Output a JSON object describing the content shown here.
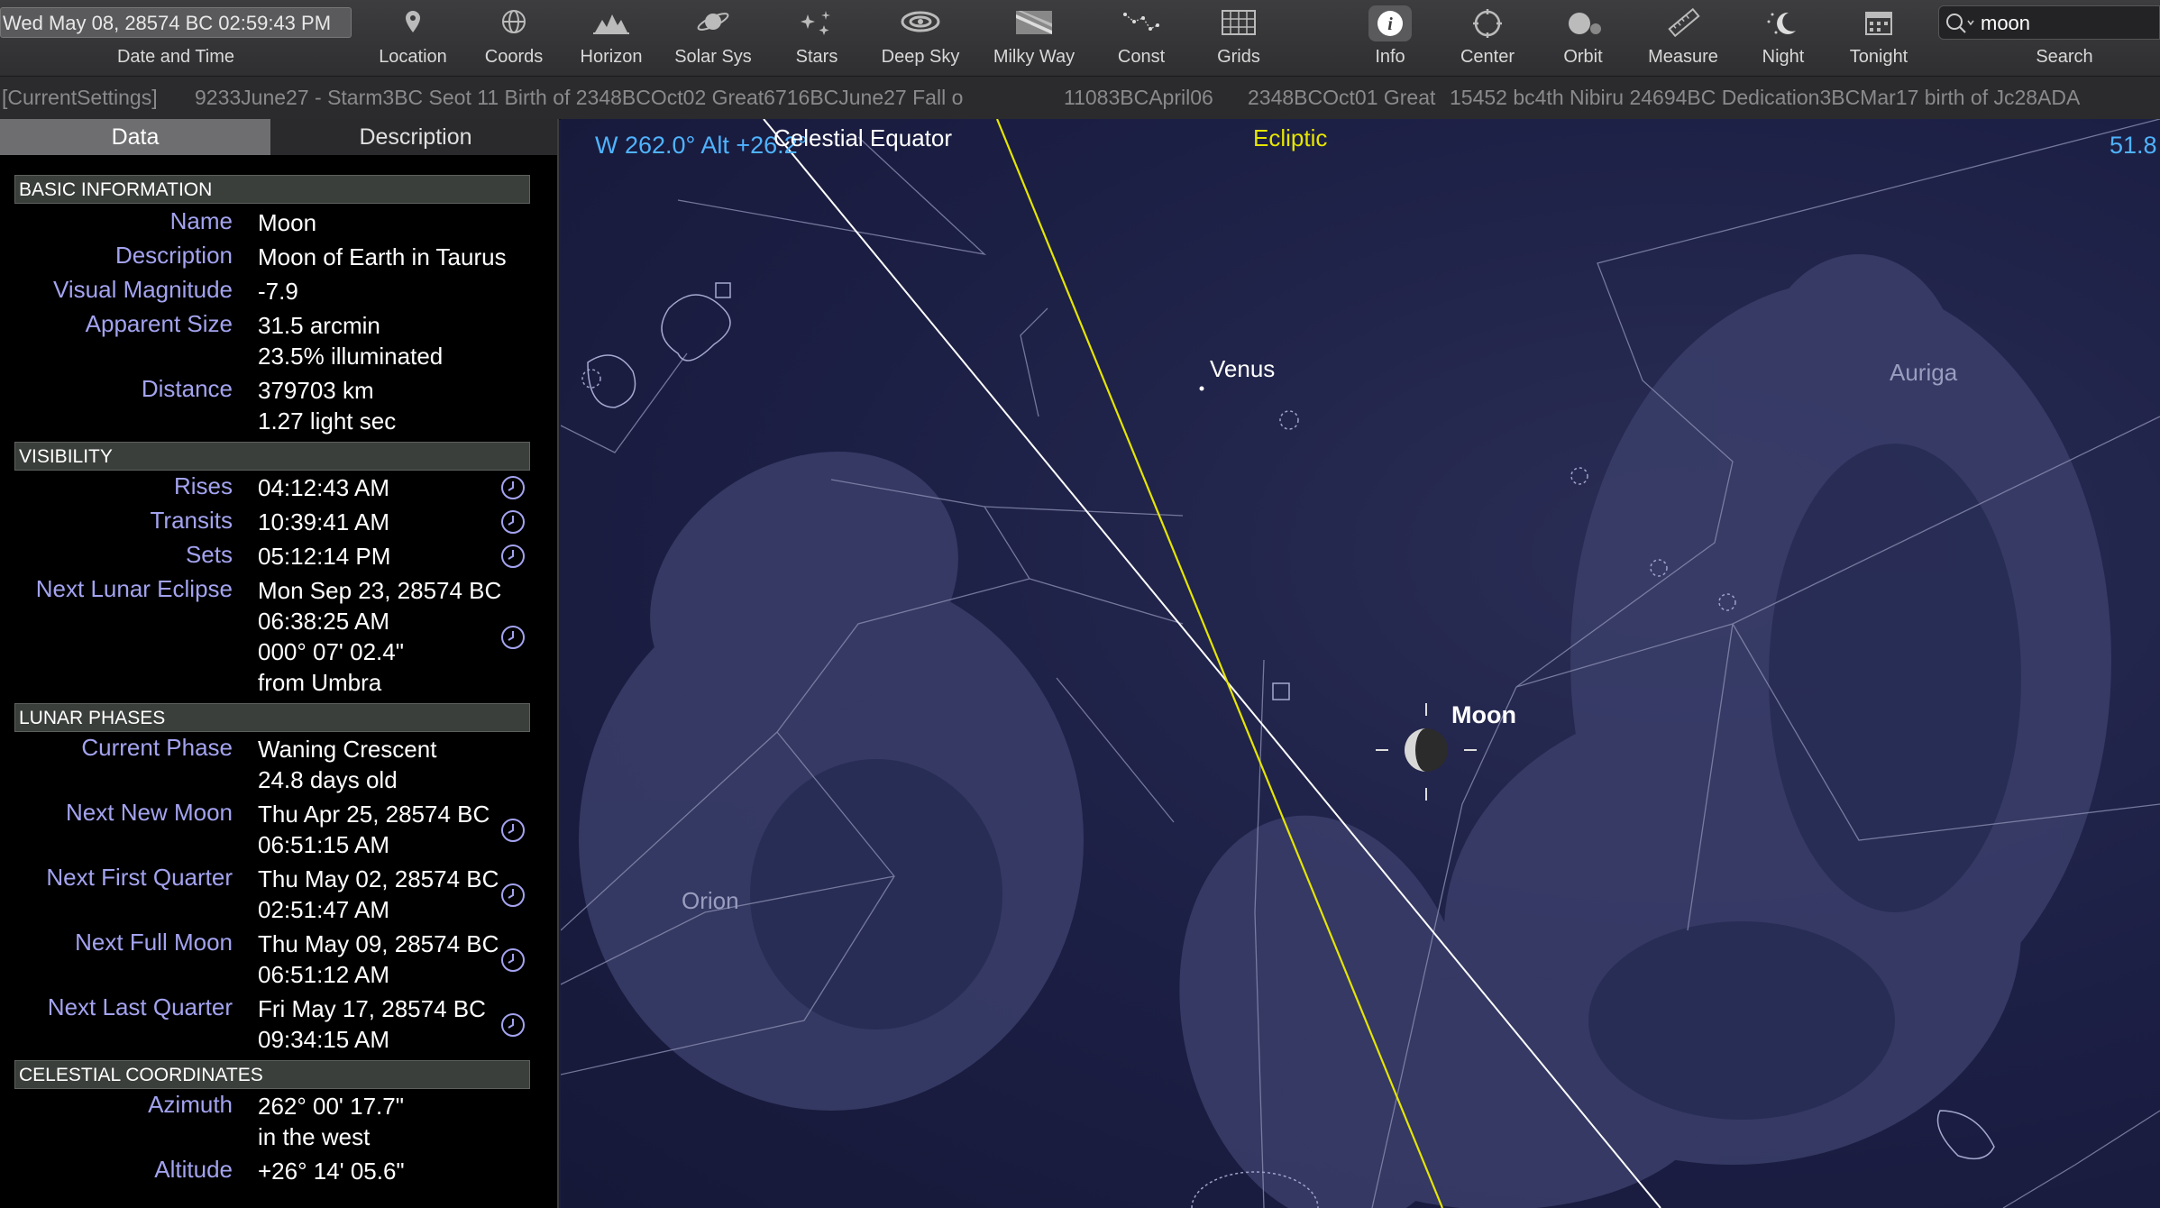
{
  "toolbar": {
    "datetime": "Wed May 08, 28574 BC 02:59:43 PM",
    "datetime_label": "Date and Time",
    "tools": [
      {
        "label": "Location",
        "icon": "location-pin-icon"
      },
      {
        "label": "Coords",
        "icon": "coords-icon"
      },
      {
        "label": "Horizon",
        "icon": "horizon-icon"
      },
      {
        "label": "Solar Sys",
        "icon": "planet-icon"
      },
      {
        "label": "Stars",
        "icon": "stars-icon"
      },
      {
        "label": "Deep Sky",
        "icon": "galaxy-icon"
      },
      {
        "label": "Milky Way",
        "icon": "milky-way-icon"
      },
      {
        "label": "Const",
        "icon": "constellation-icon"
      },
      {
        "label": "Grids",
        "icon": "grid-icon"
      },
      {
        "label": "Info",
        "icon": "info-icon"
      },
      {
        "label": "Center",
        "icon": "center-icon"
      },
      {
        "label": "Orbit",
        "icon": "orbit-icon"
      },
      {
        "label": "Measure",
        "icon": "ruler-icon"
      },
      {
        "label": "Night",
        "icon": "moon-night-icon"
      },
      {
        "label": "Tonight",
        "icon": "calendar-icon"
      }
    ],
    "search_value": "moon",
    "search_label": "Search"
  },
  "ticker": [
    "[CurrentSettings]",
    "9233June27 - Starm3BC Seot 11 Birth of 2348BCOct02 Great6716BCJune27 Fall o",
    "11083BCApril06",
    "2348BCOct01 Great",
    "15452 bc4th Nibiru 24694BC Dedication3BCMar17 birth of Jc28ADA"
  ],
  "panel": {
    "tab_data": "Data",
    "tab_description": "Description",
    "sections": {
      "basic": "BASIC INFORMATION",
      "visibility": "VISIBILITY",
      "lunar": "LUNAR PHASES",
      "celestial": "CELESTIAL COORDINATES"
    },
    "basic": {
      "name_k": "Name",
      "name_v": "Moon",
      "desc_k": "Description",
      "desc_v": "Moon of Earth in Taurus",
      "mag_k": "Visual Magnitude",
      "mag_v": "-7.9",
      "size_k": "Apparent Size",
      "size_v1": "31.5 arcmin",
      "size_v2": "23.5% illuminated",
      "dist_k": "Distance",
      "dist_v1": "379703 km",
      "dist_v2": "1.27 light sec"
    },
    "visibility": {
      "rises_k": "Rises",
      "rises_v": "04:12:43 AM",
      "transits_k": "Transits",
      "transits_v": "10:39:41 AM",
      "sets_k": "Sets",
      "sets_v": "05:12:14 PM",
      "eclipse_k": "Next Lunar Eclipse",
      "eclipse_v1": "Mon Sep 23, 28574 BC",
      "eclipse_v2": "06:38:25 AM",
      "eclipse_v3": "000° 07' 02.4\"",
      "eclipse_v4": "from Umbra"
    },
    "lunar": {
      "phase_k": "Current Phase",
      "phase_v1": "Waning Crescent",
      "phase_v2": "24.8 days old",
      "new_k": "Next New Moon",
      "new_v1": "Thu Apr 25, 28574 BC",
      "new_v2": "06:51:15 AM",
      "first_k": "Next First Quarter",
      "first_v1": "Thu May 02, 28574 BC",
      "first_v2": "02:51:47 AM",
      "full_k": "Next Full Moon",
      "full_v1": "Thu May 09, 28574 BC",
      "full_v2": "06:51:12 AM",
      "last_k": "Next Last Quarter",
      "last_v1": "Fri May 17, 28574 BC",
      "last_v2": "09:34:15 AM"
    },
    "celestial": {
      "az_k": "Azimuth",
      "az_v1": "262° 00' 17.7\"",
      "az_v2": "in the west",
      "alt_k": "Altitude",
      "alt_v": "+26° 14' 05.6\""
    }
  },
  "sky": {
    "heading": "W 262.0° Alt +26.2°",
    "fov": "51.8",
    "celestial_equator": "Celestial Equator",
    "ecliptic": "Ecliptic",
    "venus": "Venus",
    "moon": "Moon",
    "auriga": "Auriga",
    "orion": "Orion",
    "colors": {
      "ecliptic": "#e6e600",
      "equator": "#ffffff",
      "heading": "#4fb3ff",
      "key_text": "#a3a3f0"
    }
  }
}
